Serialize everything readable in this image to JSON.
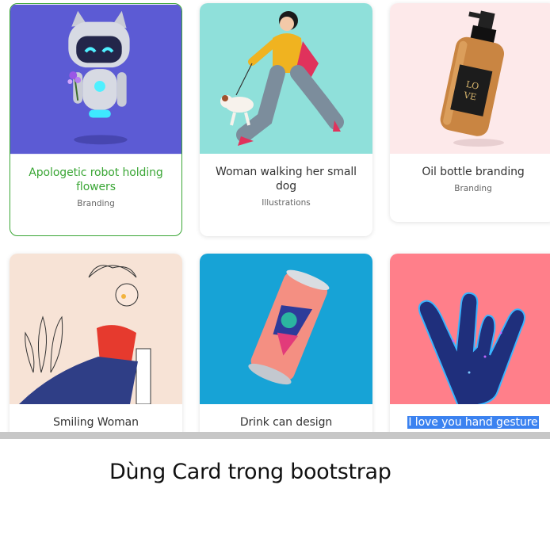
{
  "cards": [
    {
      "title": "Apologetic robot holding flowers",
      "category": "Branding",
      "bg": "#5c5bd4"
    },
    {
      "title": "Woman walking her small dog",
      "category": "Illustrations",
      "bg": "#8fe0da"
    },
    {
      "title": "Oil bottle branding",
      "category": "Branding",
      "bg": "#fde9ea"
    },
    {
      "title": "Smiling Woman",
      "category": "",
      "bg": "#f7e3d6"
    },
    {
      "title": "Drink can design",
      "category": "",
      "bg": "#17a3d6"
    },
    {
      "title": "I love you hand gesture",
      "category": "",
      "bg": "#ff7f8a"
    }
  ],
  "colors": {
    "accent_green": "#3aa635",
    "selection_blue": "#3b82f0"
  },
  "caption": "Dùng Card trong bootstrap"
}
